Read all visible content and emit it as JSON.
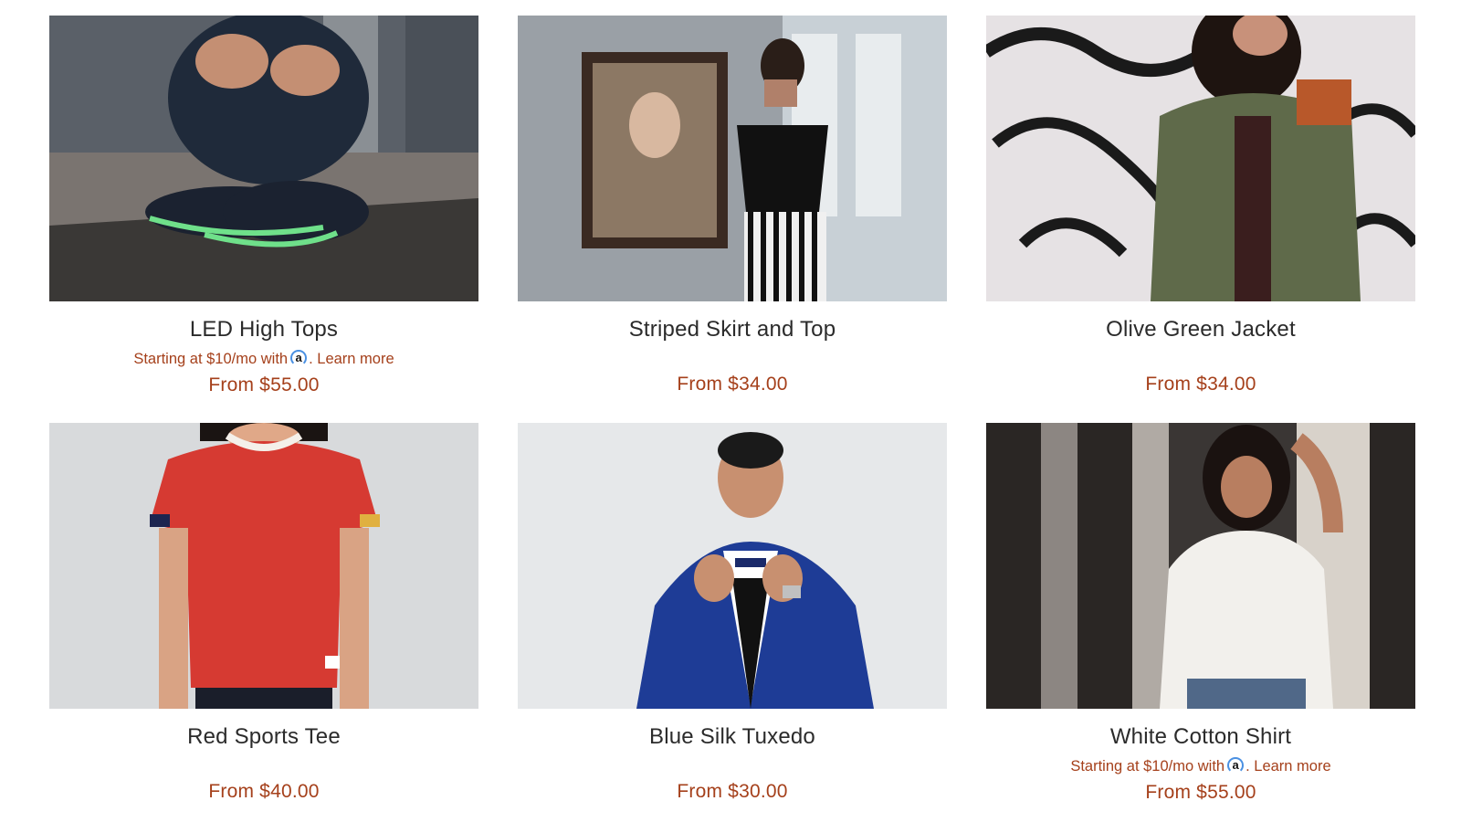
{
  "products": [
    {
      "title": "LED High Tops",
      "price": "From $55.00",
      "image_icon": "sneakers-photo",
      "affirm": {
        "prefix": "Starting at $10/mo with",
        "logo": "a",
        "learn_more": "Learn more"
      }
    },
    {
      "title": "Striped Skirt and Top",
      "price": "From $34.00",
      "image_icon": "striped-skirt-photo"
    },
    {
      "title": "Olive Green Jacket",
      "price": "From $34.00",
      "image_icon": "olive-jacket-photo"
    },
    {
      "title": "Red Sports Tee",
      "price": "From $40.00",
      "image_icon": "red-tee-photo"
    },
    {
      "title": "Blue Silk Tuxedo",
      "price": "From $30.00",
      "image_icon": "blue-tuxedo-photo"
    },
    {
      "title": "White Cotton Shirt",
      "price": "From $55.00",
      "image_icon": "white-shirt-photo",
      "affirm": {
        "prefix": "Starting at $10/mo with",
        "logo": "a",
        "learn_more": "Learn more"
      }
    }
  ],
  "colors": {
    "price": "#a5401b",
    "title": "#2b2b2b",
    "affirm_logo": "#4a90e2"
  }
}
